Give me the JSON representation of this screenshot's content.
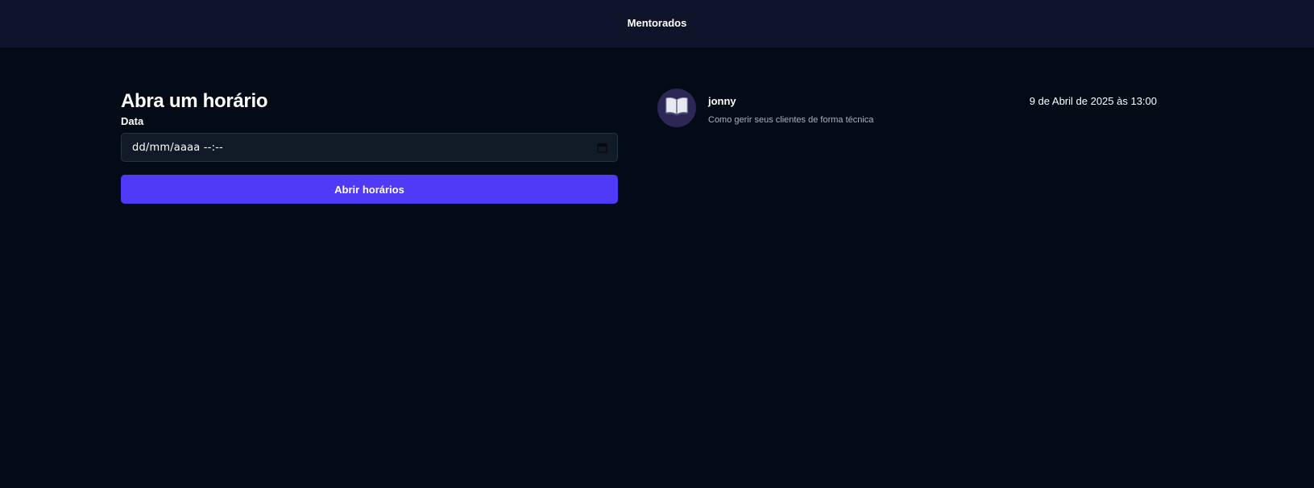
{
  "header": {
    "title": "Mentorados"
  },
  "form": {
    "heading": "Abra um horário",
    "date_label": "Data",
    "date_value": "dd/mm/aaaa --:--",
    "submit_label": "Abrir horários"
  },
  "sessions": [
    {
      "name": "jonny",
      "topic": "Como gerir seus clientes de forma técnica",
      "datetime": "9 de Abril de 2025 às 13:00",
      "icon": "open-book-icon"
    }
  ],
  "colors": {
    "background": "#030b17",
    "header_bg": "#0e152a",
    "input_bg": "#111a27",
    "accent": "#4f3bf7",
    "avatar_bg": "#2c2755"
  }
}
